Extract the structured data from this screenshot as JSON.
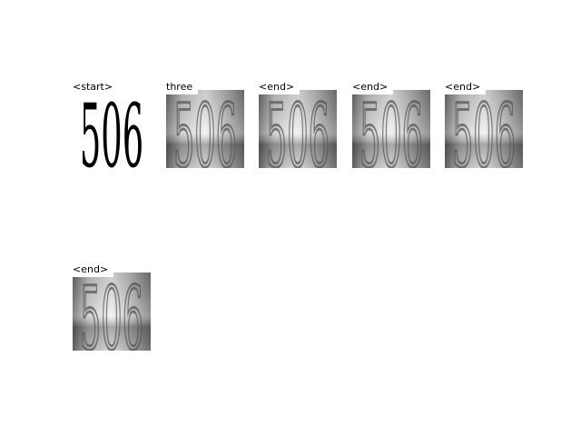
{
  "panels": [
    {
      "title": "<start>",
      "digits": "506",
      "style": "clean"
    },
    {
      "title": "three",
      "digits": "506",
      "style": "noisy"
    },
    {
      "title": "<end>",
      "digits": "506",
      "style": "noisy"
    },
    {
      "title": "<end>",
      "digits": "506",
      "style": "noisy"
    },
    {
      "title": "<end>",
      "digits": "506",
      "style": "noisy"
    },
    {
      "title": "<end>",
      "digits": "506",
      "style": "noisy"
    }
  ]
}
